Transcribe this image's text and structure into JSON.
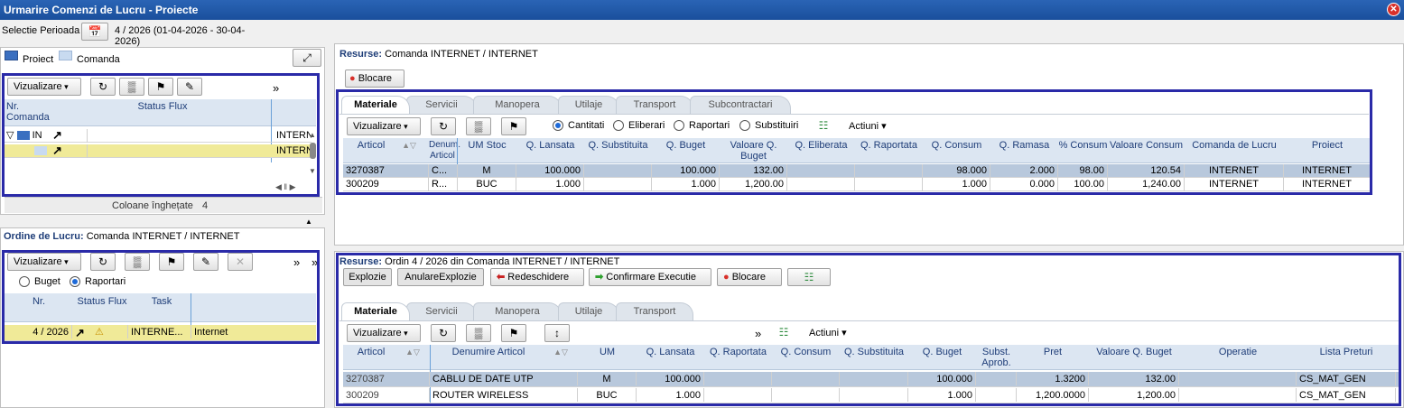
{
  "window": {
    "title": "Urmarire Comenzi de Lucru - Proiecte",
    "close_symbol": "✕"
  },
  "period": {
    "label": "Selectie Perioada",
    "value": "4 / 2026 (01-04-2026 - 30-04-2026)"
  },
  "legend": {
    "proiect": "Proiect",
    "comanda": "Comanda"
  },
  "toolbar": {
    "vizualizare": "Vizualizare",
    "more": "»",
    "actiuni": "Actiuni"
  },
  "tree": {
    "headers": [
      "Nr. Comanda",
      "Status Flux"
    ],
    "rows": [
      {
        "nr": "IN",
        "extra": "INTERN"
      },
      {
        "nr": "",
        "extra": "INTERN"
      }
    ],
    "frozen_label": "Coloane înghețate",
    "frozen_count": "4"
  },
  "orders": {
    "title_prefix": "Ordine de Lucru:",
    "title": "Comanda INTERNET / INTERNET",
    "radio_buget": "Buget",
    "radio_raportari": "Raportari",
    "headers": [
      "Nr.",
      "Status Flux",
      "Task"
    ],
    "rows": [
      {
        "nr": "4 / 2026",
        "task": "INTERNE...",
        "extra": "Internet"
      }
    ]
  },
  "resurse_top": {
    "title_prefix": "Resurse:",
    "title": "Comanda INTERNET / INTERNET",
    "blocare": "Blocare",
    "tabs": [
      "Materiale",
      "Servicii",
      "Manopera",
      "Utilaje",
      "Transport",
      "Subcontractari"
    ],
    "radios": [
      "Cantitati",
      "Eliberari",
      "Raportari",
      "Substituiri"
    ],
    "headers": [
      "Articol",
      "Denum. Articol",
      "UM Stoc",
      "Q. Lansata",
      "Q. Substituita",
      "Q. Buget",
      "Valoare Q. Buget",
      "Q. Eliberata",
      "Q. Raportata",
      "Q. Consum",
      "Q. Ramasa",
      "% Consum",
      "Valoare Consum",
      "Comanda de Lucru",
      "Proiect"
    ],
    "rows": [
      [
        "3270387",
        "C...",
        "M",
        "100.000",
        "",
        "100.000",
        "132.00",
        "",
        "",
        "98.000",
        "2.000",
        "98.00",
        "120.54",
        "INTERNET",
        "INTERNET"
      ],
      [
        "300209",
        "R...",
        "BUC",
        "1.000",
        "",
        "1.000",
        "1,200.00",
        "",
        "",
        "1.000",
        "0.000",
        "100.00",
        "1,240.00",
        "INTERNET",
        "INTERNET"
      ]
    ]
  },
  "resurse_bottom": {
    "title_prefix": "Resurse:",
    "title": "Ordin 4 / 2026 din Comanda INTERNET / INTERNET",
    "buttons": {
      "explozie": "Explozie",
      "anulare": "AnulareExplozie",
      "redeschidere": "Redeschidere",
      "confirmare": "Confirmare Executie",
      "blocare": "Blocare"
    },
    "tabs": [
      "Materiale",
      "Servicii",
      "Manopera",
      "Utilaje",
      "Transport"
    ],
    "headers": [
      "Articol",
      "Denumire Articol",
      "UM",
      "Q. Lansata",
      "Q. Raportata",
      "Q. Consum",
      "Q. Substituita",
      "Q. Buget",
      "Subst. Aprob.",
      "Pret",
      "Valoare Q. Buget",
      "Operatie",
      "Lista Preturi"
    ],
    "rows": [
      [
        "3270387",
        "CABLU DE DATE UTP",
        "M",
        "100.000",
        "",
        "",
        "",
        "100.000",
        "",
        "1.3200",
        "132.00",
        "",
        "CS_MAT_GEN"
      ],
      [
        "300209",
        "ROUTER WIRELESS",
        "BUC",
        "1.000",
        "",
        "",
        "",
        "1.000",
        "",
        "1,200.0000",
        "1,200.00",
        "",
        "CS_MAT_GEN"
      ]
    ]
  },
  "colors": {
    "title_bar": "#1a4f9c",
    "highlight_box": "#2a2aa8",
    "selected_row": "#b8c8dc",
    "yellow_row": "#f0ea98"
  }
}
